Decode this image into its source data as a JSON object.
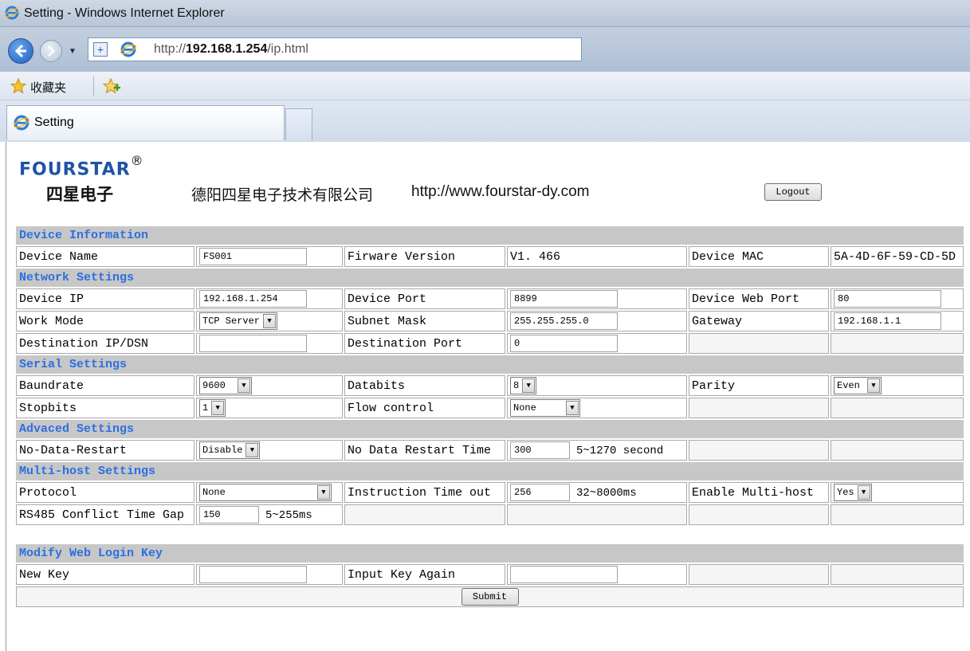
{
  "window": {
    "title": "Setting - Windows Internet Explorer",
    "url_prefix": "http://",
    "url_host": "192.168.1.254",
    "url_path": "/ip.html",
    "favorites_label": "收藏夹",
    "tab_label": "Setting"
  },
  "header": {
    "brand": "FOURSTAR",
    "brand_mark": "®",
    "brand_cn": "四星电子",
    "company": "德阳四星电子技术有限公司",
    "website": "http://www.fourstar-dy.com",
    "logout_label": "Logout"
  },
  "device_info": {
    "section": "Device Information",
    "name_label": "Device Name",
    "name_value": "FS001",
    "fw_label": "Firware Version",
    "fw_value": "V1. 466",
    "mac_label": "Device MAC",
    "mac_value": "5A-4D-6F-59-CD-5D"
  },
  "network": {
    "section": "Network Settings",
    "ip_label": "Device IP",
    "ip_value": "192.168.1.254",
    "port_label": "Device Port",
    "port_value": "8899",
    "web_port_label": "Device Web Port",
    "web_port_value": "80",
    "mode_label": "Work Mode",
    "mode_value": "TCP Server",
    "mask_label": "Subnet Mask",
    "mask_value": "255.255.255.0",
    "gateway_label": "Gateway",
    "gateway_value": "192.168.1.1",
    "dest_ip_label": "Destination IP/DSN",
    "dest_ip_value": "",
    "dest_port_label": "Destination Port",
    "dest_port_value": "0"
  },
  "serial": {
    "section": "Serial Settings",
    "baud_label": "Baundrate",
    "baud_value": "9600",
    "databits_label": "Databits",
    "databits_value": "8",
    "parity_label": "Parity",
    "parity_value": "Even",
    "stopbits_label": "Stopbits",
    "stopbits_value": "1",
    "flow_label": "Flow control",
    "flow_value": "None"
  },
  "advanced": {
    "section": "Advaced Settings",
    "restart_label": "No-Data-Restart",
    "restart_value": "Disable",
    "restart_time_label": "No Data Restart Time",
    "restart_time_value": "300",
    "restart_time_hint": "5~1270 second"
  },
  "multihost": {
    "section": "Multi-host Settings",
    "protocol_label": "Protocol",
    "protocol_value": "None",
    "timeout_label": "Instruction Time out",
    "timeout_value": "256",
    "timeout_hint": "32~8000ms",
    "enable_label": "Enable Multi-host",
    "enable_value": "Yes",
    "gap_label": "RS485 Conflict Time Gap",
    "gap_value": "150",
    "gap_hint": "5~255ms"
  },
  "login_key": {
    "section": "Modify Web Login Key",
    "new_key_label": "New Key",
    "new_key_value": "",
    "again_label": "Input Key Again",
    "again_value": "",
    "submit_label": "Submit"
  },
  "icons": {
    "dropdown_arrow": "▼",
    "ie_logo": "ie-logo-icon",
    "favorites_star": "star-icon"
  }
}
